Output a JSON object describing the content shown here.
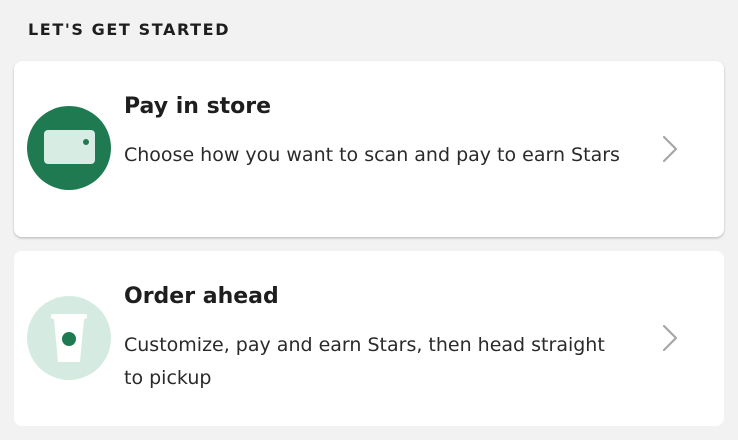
{
  "section": {
    "title": "LET'S GET STARTED"
  },
  "cards": [
    {
      "title": "Pay in store",
      "description": "Choose how you want to scan and pay to earn Stars",
      "icon": "payment-card-icon"
    },
    {
      "title": "Order ahead",
      "description": "Customize, pay and earn Stars, then head straight to pickup",
      "icon": "coffee-cup-icon"
    }
  ],
  "colors": {
    "brand_green": "#1f7a52",
    "light_green": "#d5ebe2",
    "background": "#f2f2f2"
  }
}
